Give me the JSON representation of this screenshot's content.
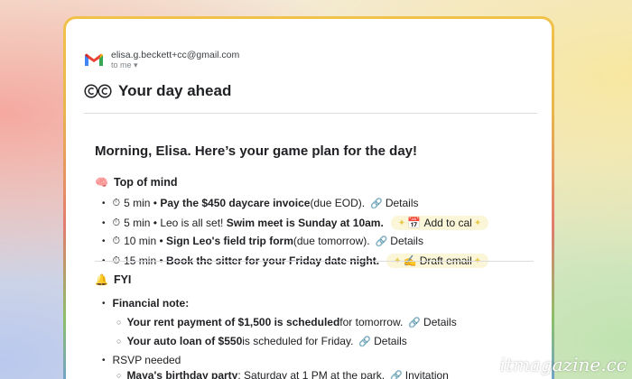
{
  "email": {
    "sender_address": "elisa.g.beckett+cc@gmail.com",
    "recipient_line": "to me",
    "title": "Your day ahead",
    "greeting": "Morning, Elisa. Here’s your game plan for the day!"
  },
  "top_of_mind": {
    "emoji": "🧠",
    "heading": "Top of mind",
    "items": [
      {
        "time": "5 min",
        "bold": "Pay the $450 daycare invoice",
        "normal": " (due EOD).",
        "action": "Details"
      },
      {
        "time": "5 min",
        "normal_before": "Leo is all set! ",
        "bold": "Swim meet is Sunday at 10am.",
        "action": "Add to cal"
      },
      {
        "time": "10 min",
        "bold": "Sign Leo's field trip form",
        "normal": " (due tomorrow).",
        "action": "Details"
      },
      {
        "time": "15 min",
        "bold": "Book the sitter for your Friday date night.",
        "action": "Draft email"
      }
    ]
  },
  "fyi": {
    "emoji": "🔔",
    "heading": "FYI",
    "financial_note": "Financial note:",
    "financial_items": [
      {
        "bold": "Your rent payment of $1,500 is scheduled",
        "normal": " for tomorrow.",
        "action": "Details"
      },
      {
        "bold": "Your auto loan of $550",
        "normal": " is scheduled for Friday.",
        "action": "Details"
      }
    ],
    "rsvp_heading": "RSVP needed",
    "rsvp_items": [
      {
        "bold": "Maya's birthday party",
        "normal": ": Saturday at 1 PM at the park.",
        "action": "Invitation"
      }
    ]
  },
  "watermark": "itmagazine.cc",
  "colors": {
    "chip_background": "#fbf6d7",
    "frame_gradient": [
      "#f1c24a",
      "#e37b6e",
      "#8bbf6a",
      "#6d9be0"
    ]
  }
}
